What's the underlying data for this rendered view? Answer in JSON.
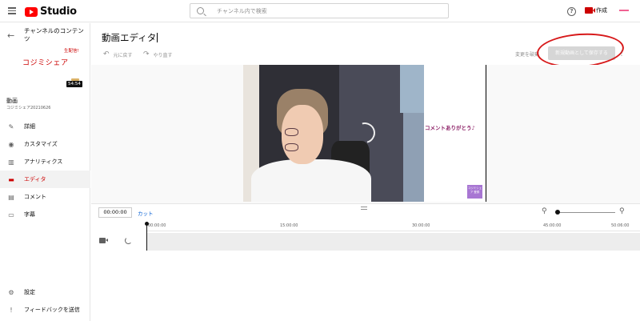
{
  "topbar": {
    "logo_text": "Studio",
    "search_placeholder": "チャンネル内で検索",
    "help_icon": "help-icon",
    "create_label": "作成"
  },
  "sidebar": {
    "channel_title": "チャンネルのコンテンツ",
    "live_badge": "生配信!",
    "thumbnail_name": "コジミシェア",
    "duration": "54:54",
    "section_title": "動画",
    "section_subtitle": "コジミシェア20210626",
    "items": [
      {
        "label": "詳細",
        "icon": "pencil-icon"
      },
      {
        "label": "カスタマイズ",
        "icon": "broadcast-icon"
      },
      {
        "label": "アナリティクス",
        "icon": "analytics-icon"
      },
      {
        "label": "エディタ",
        "icon": "editor-icon",
        "active": true
      },
      {
        "label": "コメント",
        "icon": "comment-icon"
      },
      {
        "label": "字幕",
        "icon": "subtitles-icon"
      }
    ],
    "bottom_items": [
      {
        "label": "設定",
        "icon": "gear-icon"
      },
      {
        "label": "フィードバックを送信",
        "icon": "feedback-icon"
      }
    ]
  },
  "editor": {
    "title": "動画エディタ",
    "undo_label": "元に戻す",
    "redo_label": "やり直す",
    "discard_label": "変更を破棄",
    "save_label": "新規動画として保存する"
  },
  "preview": {
    "comment_overlay": "コメントありがとう♪",
    "badge_text": "コジミシェア 登録"
  },
  "timeline": {
    "current_time": "00:00:00",
    "cut_label": "カット",
    "ticks": [
      "00:00:00",
      "15:00:00",
      "30:00:00",
      "45:00:00",
      "50:06:00"
    ]
  },
  "colors": {
    "brand_red": "#ff0000",
    "active_red": "#cc0000",
    "link_blue": "#065fd4",
    "annotation_red": "#d7191a"
  }
}
